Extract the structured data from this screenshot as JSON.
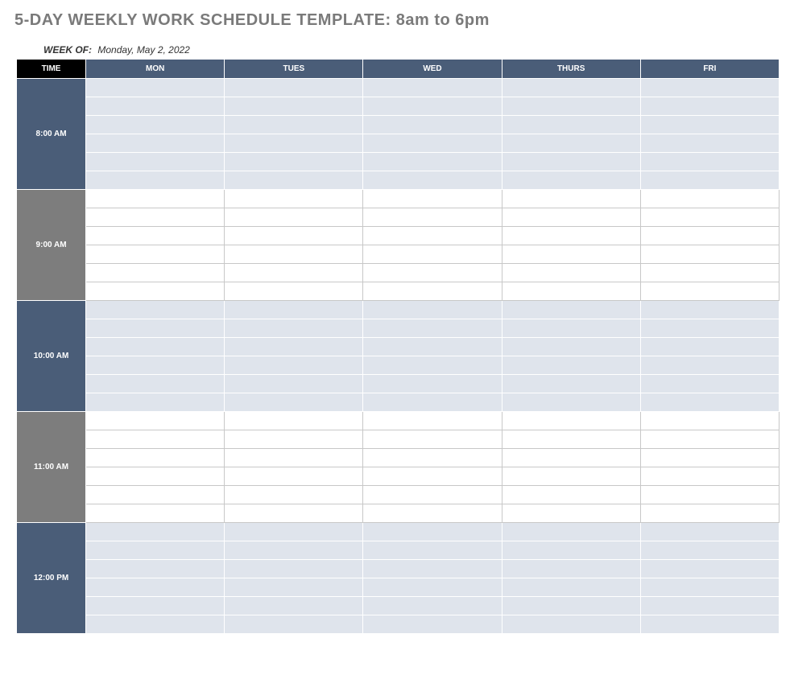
{
  "title": "5-DAY WEEKLY WORK SCHEDULE TEMPLATE: 8am to 6pm",
  "week_of_label": "WEEK OF:",
  "week_of_value": "Monday, May 2, 2022",
  "headers": {
    "time": "TIME",
    "days": [
      "MON",
      "TUES",
      "WED",
      "THURS",
      "FRI"
    ]
  },
  "time_slots": [
    {
      "label": "8:00 AM",
      "tone": "blue"
    },
    {
      "label": "9:00 AM",
      "tone": "grey"
    },
    {
      "label": "10:00 AM",
      "tone": "blue"
    },
    {
      "label": "11:00 AM",
      "tone": "grey"
    },
    {
      "label": "12:00 PM",
      "tone": "blue"
    }
  ],
  "sub_rows_per_slot": 6
}
